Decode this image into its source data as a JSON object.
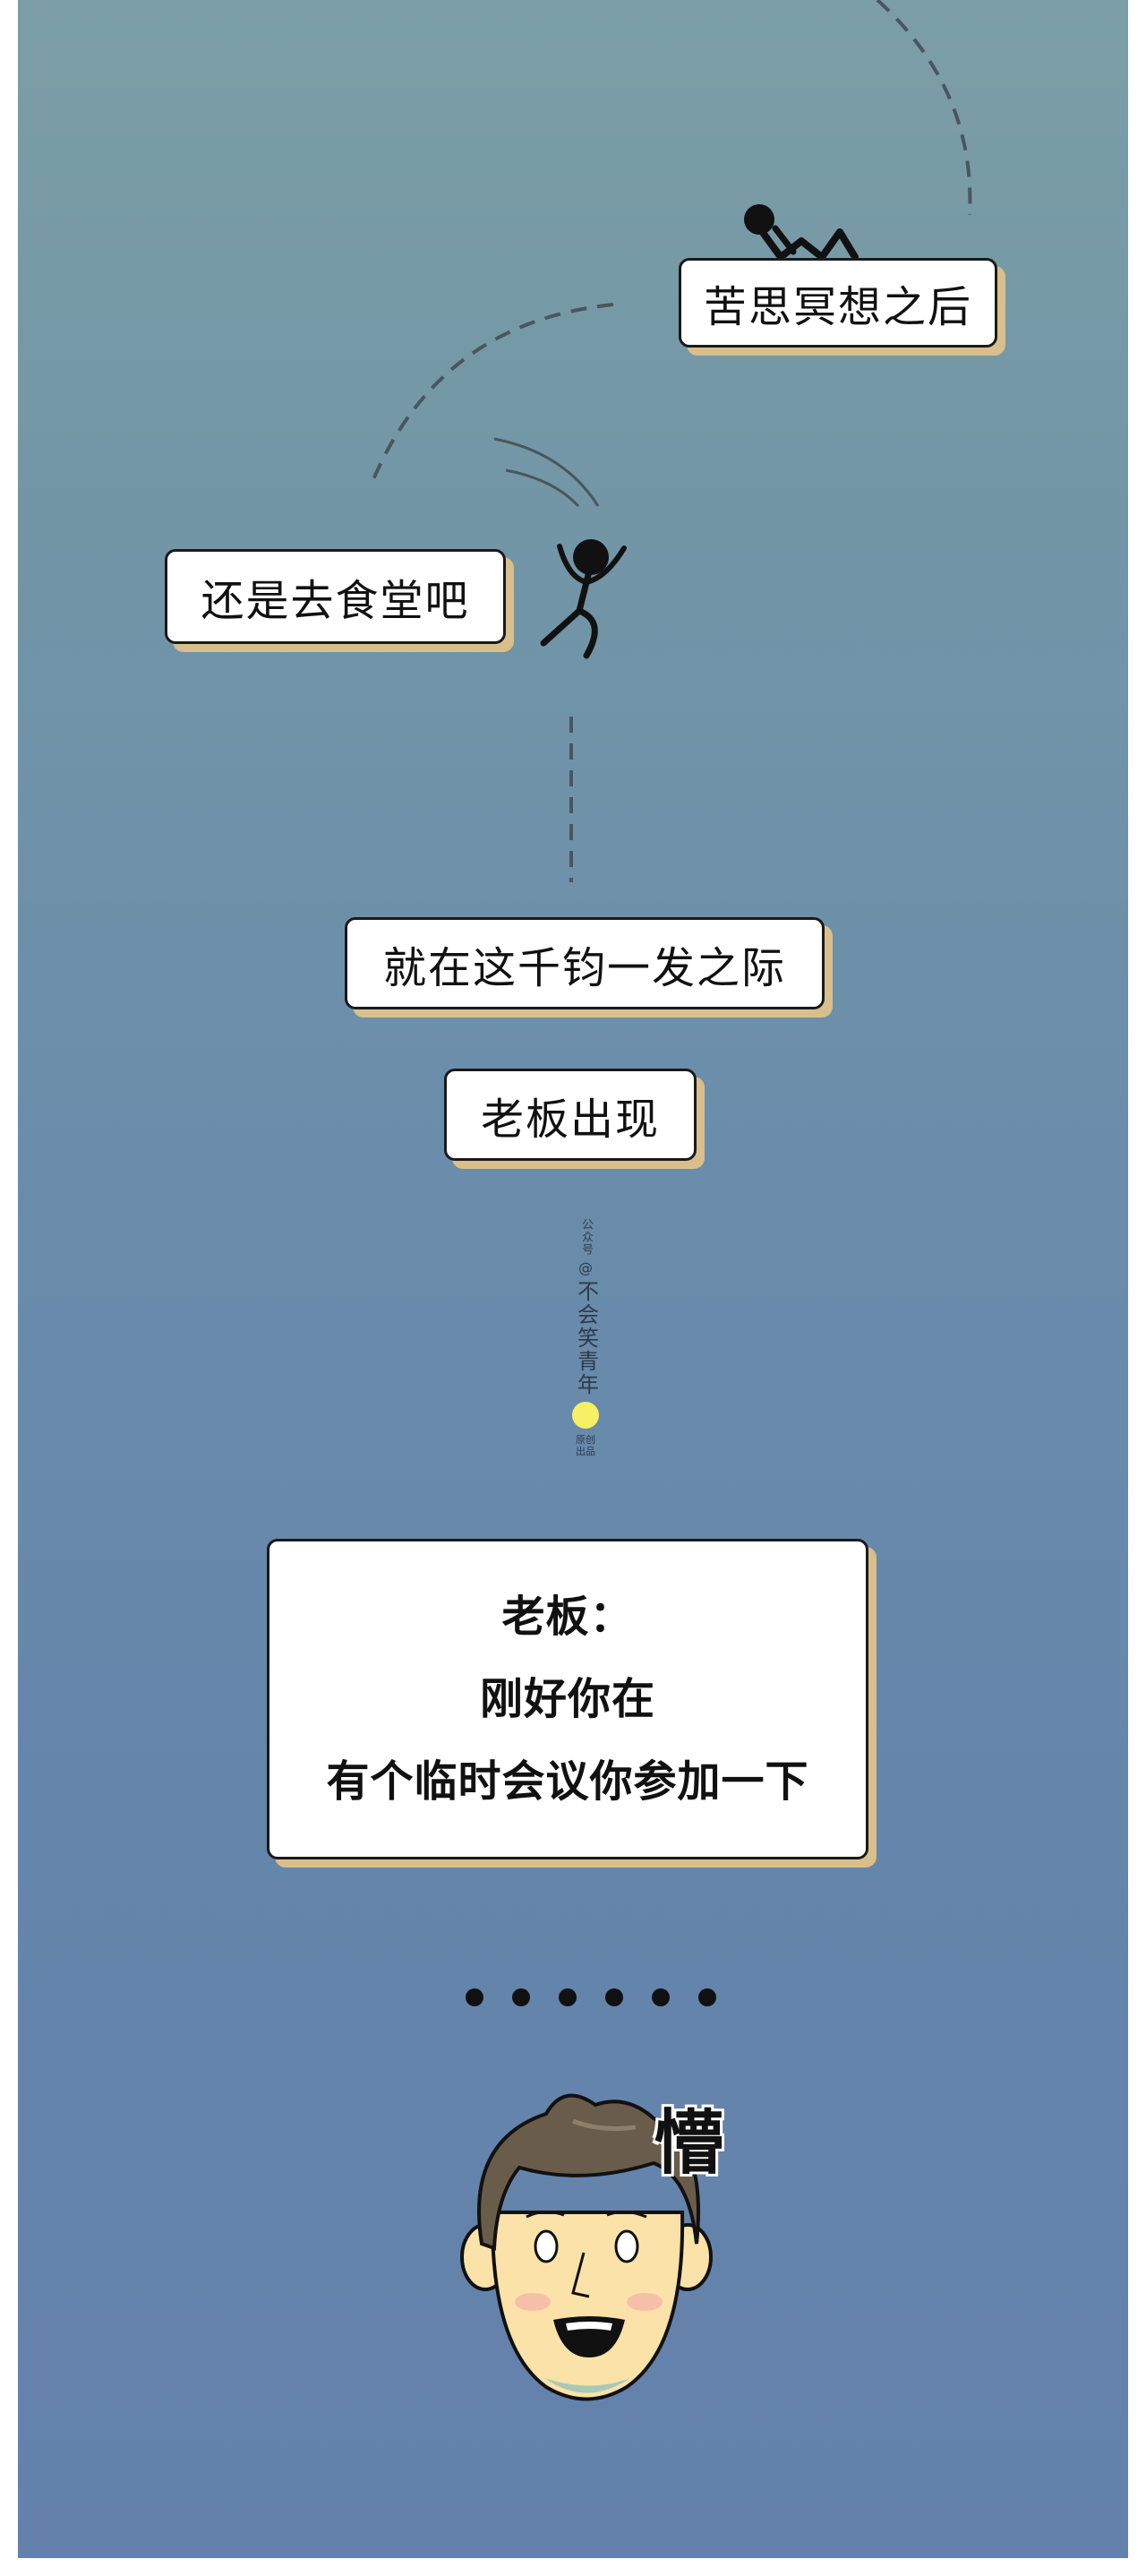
{
  "bubbles": {
    "think": "苦思冥想之后",
    "canteen": "还是去食堂吧",
    "critical": "就在这千钧一发之际",
    "boss_appears": "老板出现"
  },
  "boss_speech": {
    "line1": "老板：",
    "line2": "刚好你在",
    "line3": "有个临时会议你参加一下"
  },
  "watermark": {
    "prefix": "公众号",
    "at": "@",
    "name": "不会笑青年",
    "suffix_line1": "原创",
    "suffix_line2": "出品"
  },
  "reaction": "懵",
  "ellipsis_dot_count": 6,
  "colors": {
    "bubble_shadow": "#d8bf8c",
    "sun": "#f7ef66",
    "background_top": "#7b9ea6",
    "background_bottom": "#6381ab"
  }
}
